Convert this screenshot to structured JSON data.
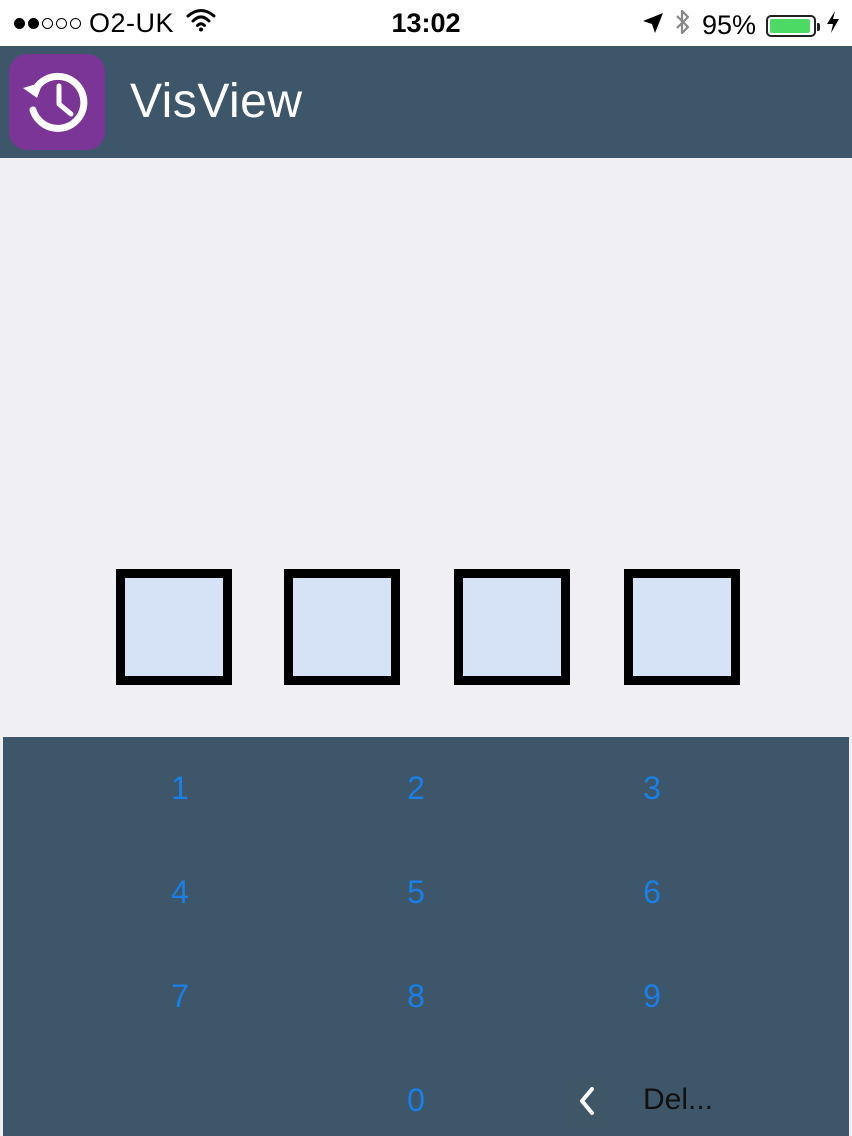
{
  "status_bar": {
    "signal_dots": [
      true,
      true,
      false,
      false,
      false
    ],
    "carrier": "O2-UK",
    "wifi_icon": "wifi-icon",
    "time": "13:02",
    "location_icon": "location-arrow-icon",
    "bluetooth_icon": "bluetooth-icon",
    "battery_percent": "95%",
    "battery_level": 0.95,
    "charging_icon": "bolt-icon"
  },
  "header": {
    "app_icon": "history-clock-icon",
    "title": "VisView",
    "color": "#3d566a",
    "icon_color": "#7a3596"
  },
  "pin": {
    "length": 4,
    "box_color": "#d6e2f6"
  },
  "keypad": {
    "keys": [
      "1",
      "2",
      "3",
      "4",
      "5",
      "6",
      "7",
      "8",
      "9",
      "0"
    ],
    "key_color": "#1a7fe6",
    "back_icon": "chevron-left-icon",
    "delete_label": "Del..."
  }
}
